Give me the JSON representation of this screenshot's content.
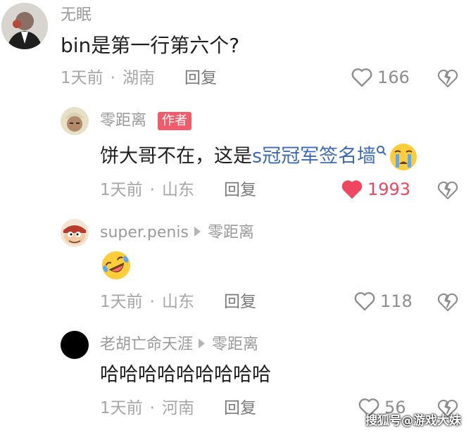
{
  "comments": [
    {
      "username": "无眠",
      "avatar_icon": "tuxedo-man-avatar",
      "content": "bin是第一行第六个?",
      "time": "1天前",
      "location": "湖南",
      "reply_label": "回复",
      "likes": "166",
      "liked": false
    },
    {
      "username": "零距离",
      "badge": "作者",
      "avatar_icon": "face-photo-avatar",
      "content_prefix": "饼大哥不在，这是",
      "content_link": "s冠冠军签名墙",
      "content_emoji": "loudly-crying-face-emoji",
      "time": "1天前",
      "location": "山东",
      "reply_label": "回复",
      "likes": "1993",
      "liked": true,
      "accent_color": "#f04660"
    },
    {
      "username": "super.penis",
      "reply_to": "零距离",
      "avatar_icon": "cartoon-character-avatar",
      "content_emoji": "rolling-laughing-emoji",
      "time": "1天前",
      "location": "山东",
      "reply_label": "回复",
      "likes": "118",
      "liked": false
    },
    {
      "username": "老胡亡命天涯",
      "reply_to": "零距离",
      "avatar_icon": "black-circle-avatar",
      "content": "哈哈哈哈哈哈哈哈哈",
      "time": "1天前",
      "location": "河南",
      "reply_label": "回复",
      "likes": "56",
      "liked": false
    }
  ],
  "watermark": "搜狐号@游戏大妹"
}
